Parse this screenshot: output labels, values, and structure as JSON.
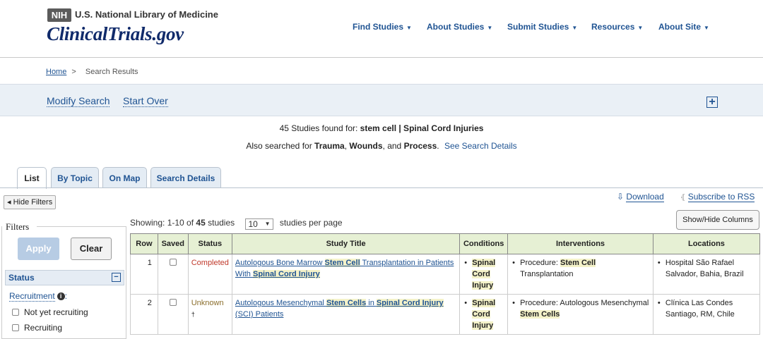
{
  "header": {
    "nih_badge": "NIH",
    "nlm_name": "U.S. National Library of Medicine",
    "site_logo": "ClinicalTrials.gov",
    "nav": [
      "Find Studies",
      "About Studies",
      "Submit Studies",
      "Resources",
      "About Site"
    ]
  },
  "breadcrumb": {
    "home": "Home",
    "separator": ">",
    "current": "Search Results"
  },
  "modify_bar": {
    "modify": "Modify Search",
    "start_over": "Start Over",
    "expand_icon": "plus-square-icon"
  },
  "summary": {
    "count_text": "45 Studies found for:",
    "query": "stem cell | Spinal Cord Injuries",
    "also_prefix": "Also searched for",
    "also_terms": [
      "Trauma",
      "Wounds",
      "Process"
    ],
    "also_and": "and",
    "details_link": "See Search Details"
  },
  "tabs": [
    "List",
    "By Topic",
    "On Map",
    "Search Details"
  ],
  "left_panel": {
    "hide_filters": "Hide Filters",
    "filters_title": "Filters",
    "apply": "Apply",
    "clear": "Clear",
    "status_section": "Status",
    "recruitment_label": "Recruitment",
    "recruitment_options": [
      "Not yet recruiting",
      "Recruiting"
    ]
  },
  "tools": {
    "download": "Download",
    "subscribe": "Subscribe to RSS",
    "show_hide": "Show/Hide Columns",
    "showing_prefix": "Showing: 1-10 of",
    "showing_total": "45",
    "showing_suffix": "studies",
    "per_page_value": "10",
    "per_page_suffix": "studies per page"
  },
  "table": {
    "columns": [
      "Row",
      "Saved",
      "Status",
      "Study Title",
      "Conditions",
      "Interventions",
      "Locations"
    ],
    "rows": [
      {
        "row": "1",
        "status": "Completed",
        "title_parts": [
          "Autologous Bone Marrow ",
          "Stem Cell",
          " Transplantation in Patients With ",
          "Spinal Cord Injury"
        ],
        "conditions": [
          "Spinal",
          "Cord",
          "Injury"
        ],
        "intervention_parts": [
          "Procedure: ",
          "Stem Cell",
          " Transplantation"
        ],
        "location": "Hospital São Rafael Salvador, Bahia, Brazil"
      },
      {
        "row": "2",
        "status": "Unknown",
        "status_mark": "†",
        "title_parts": [
          "Autologous Mesenchymal ",
          "Stem Cells",
          " in ",
          "Spinal Cord Injury",
          " (SCI) Patients"
        ],
        "conditions": [
          "Spinal",
          "Cord",
          "Injury"
        ],
        "intervention_parts": [
          "Procedure: Autologous Mesenchymal ",
          "Stem Cells"
        ],
        "location": "Clínica Las Condes Santiago, RM, Chile"
      }
    ]
  }
}
